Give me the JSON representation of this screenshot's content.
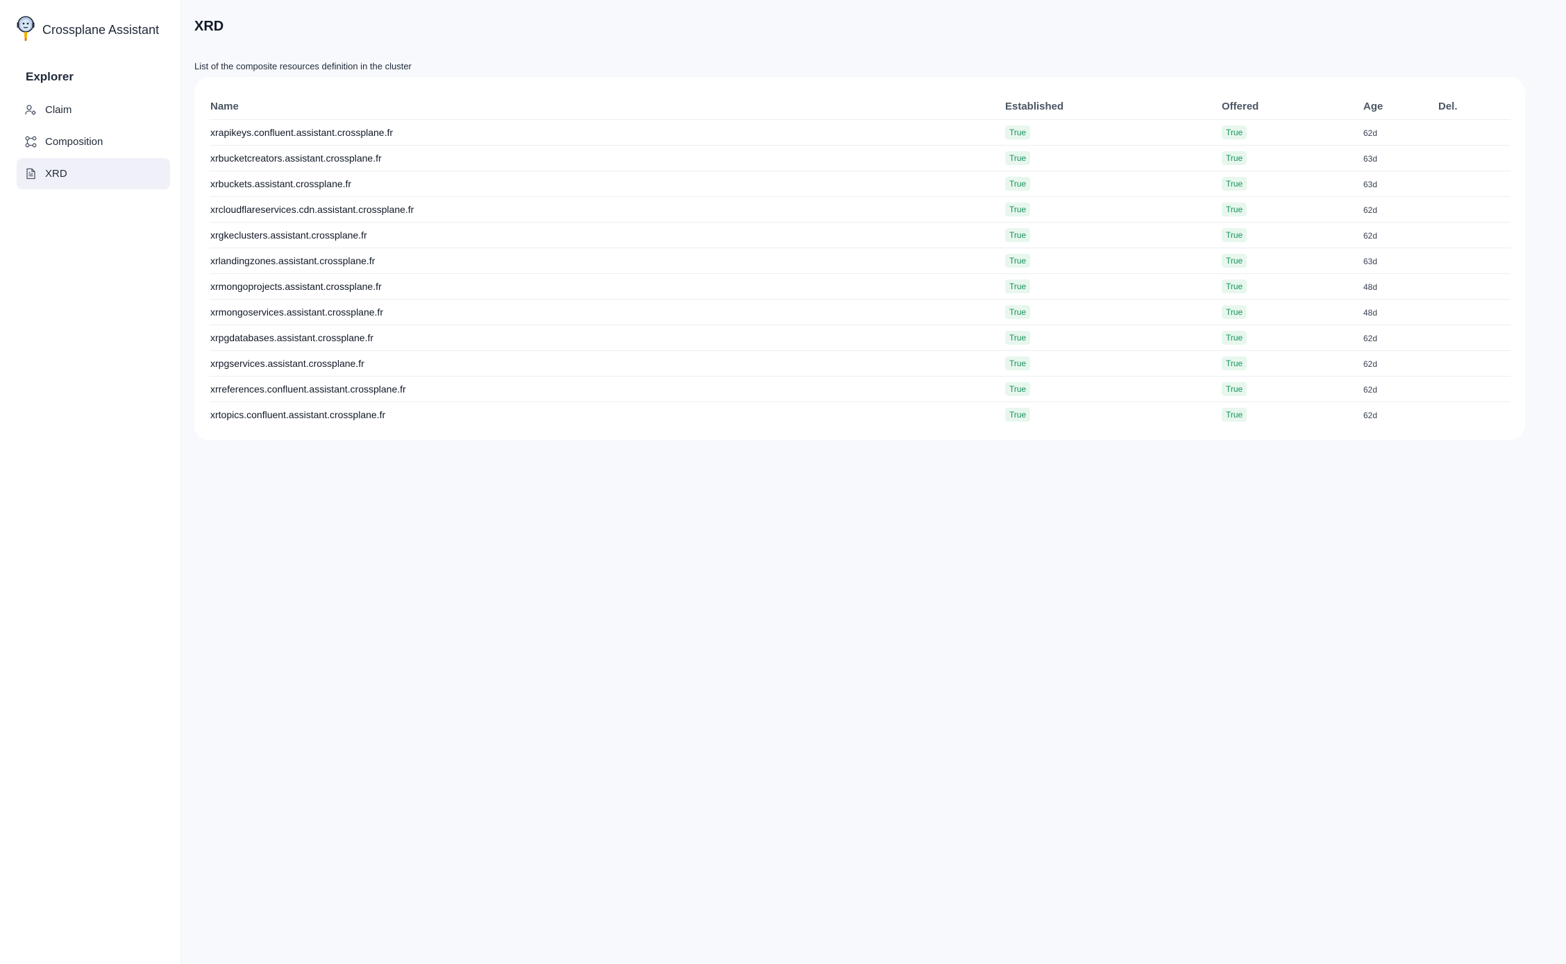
{
  "app": {
    "name": "Crossplane Assistant"
  },
  "sidebar": {
    "section_title": "Explorer",
    "items": [
      {
        "label": "Claim",
        "icon": "user-settings-icon",
        "active": false
      },
      {
        "label": "Composition",
        "icon": "workflow-icon",
        "active": false
      },
      {
        "label": "XRD",
        "icon": "file-text-icon",
        "active": true
      }
    ]
  },
  "page": {
    "title": "XRD",
    "subtitle": "List of the composite resources definition in the cluster"
  },
  "table": {
    "columns": [
      "Name",
      "Established",
      "Offered",
      "Age",
      "Del."
    ],
    "rows": [
      {
        "name": "xrapikeys.confluent.assistant.crossplane.fr",
        "established": "True",
        "offered": "True",
        "age": "62d"
      },
      {
        "name": "xrbucketcreators.assistant.crossplane.fr",
        "established": "True",
        "offered": "True",
        "age": "63d"
      },
      {
        "name": "xrbuckets.assistant.crossplane.fr",
        "established": "True",
        "offered": "True",
        "age": "63d"
      },
      {
        "name": "xrcloudflareservices.cdn.assistant.crossplane.fr",
        "established": "True",
        "offered": "True",
        "age": "62d"
      },
      {
        "name": "xrgkeclusters.assistant.crossplane.fr",
        "established": "True",
        "offered": "True",
        "age": "62d"
      },
      {
        "name": "xrlandingzones.assistant.crossplane.fr",
        "established": "True",
        "offered": "True",
        "age": "63d"
      },
      {
        "name": "xrmongoprojects.assistant.crossplane.fr",
        "established": "True",
        "offered": "True",
        "age": "48d"
      },
      {
        "name": "xrmongoservices.assistant.crossplane.fr",
        "established": "True",
        "offered": "True",
        "age": "48d"
      },
      {
        "name": "xrpgdatabases.assistant.crossplane.fr",
        "established": "True",
        "offered": "True",
        "age": "62d"
      },
      {
        "name": "xrpgservices.assistant.crossplane.fr",
        "established": "True",
        "offered": "True",
        "age": "62d"
      },
      {
        "name": "xrreferences.confluent.assistant.crossplane.fr",
        "established": "True",
        "offered": "True",
        "age": "62d"
      },
      {
        "name": "xrtopics.confluent.assistant.crossplane.fr",
        "established": "True",
        "offered": "True",
        "age": "62d"
      }
    ]
  },
  "colors": {
    "badge_text": "#15935a",
    "badge_bg": "#e8f7ee",
    "active_nav_bg": "#f0f1f8",
    "page_bg": "#f8f9fc"
  }
}
